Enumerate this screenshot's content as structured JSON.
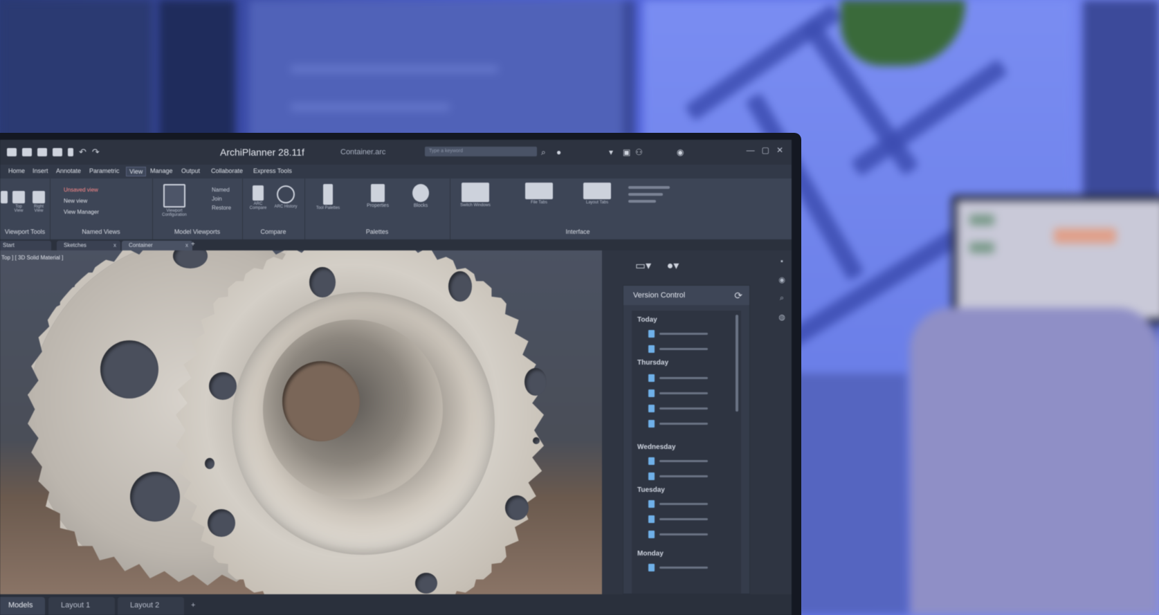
{
  "app": {
    "title": "ArchiPlanner 28.11f",
    "document": "Container.arc",
    "search_placeholder": "Type a keyword"
  },
  "menu": [
    "Home",
    "Insert",
    "Annotate",
    "Parametric",
    "View",
    "Manage",
    "Output",
    "Collaborate",
    "Express Tools"
  ],
  "menu_active": "View",
  "ribbon": {
    "viewport_tools_label": "Viewport Tools",
    "view_buttons": [
      "Top View",
      "Right View"
    ],
    "named_views": {
      "label": "Named Views",
      "unsaved": "Unsaved view",
      "new_view": "New view",
      "manager": "View Manager"
    },
    "model_viewports": {
      "label": "Model Viewports",
      "config": "Viewport Configuration",
      "named": "Named",
      "join": "Join",
      "restore": "Restore"
    },
    "compare": {
      "label": "Compare",
      "arc_compare": "ARC Compare",
      "arc_history": "ARC History"
    },
    "palettes": {
      "label": "Palettes",
      "tool_palettes": "Tool Palettes",
      "properties": "Properties",
      "blocks": "Blocks"
    },
    "interface": {
      "label": "Interface",
      "switch_windows": "Switch Windows",
      "file_tabs": "File Tabs",
      "layout_tabs": "Layout Tabs"
    }
  },
  "doc_tabs": [
    "Start",
    "Sketches",
    "Container"
  ],
  "doc_tab_active": "Container",
  "viewport": {
    "label": "Top ] [ 3D Solid Material ]"
  },
  "version_control": {
    "title": "Version Control",
    "groups": [
      {
        "day": "Today",
        "files": 2
      },
      {
        "day": "Thursday",
        "files": 4
      },
      {
        "day": "Wednesday",
        "files": 2
      },
      {
        "day": "Tuesday",
        "files": 3
      },
      {
        "day": "Monday",
        "files": 1
      }
    ]
  },
  "layout_tabs": [
    "Models",
    "Layout 1",
    "Layout 2"
  ],
  "layout_tab_active": "Models",
  "colors": {
    "accent_blue": "#6fb0e8",
    "ui_dark": "#2d3340",
    "ribbon": "#3d4556",
    "room_blue": "#5b6ee6"
  }
}
